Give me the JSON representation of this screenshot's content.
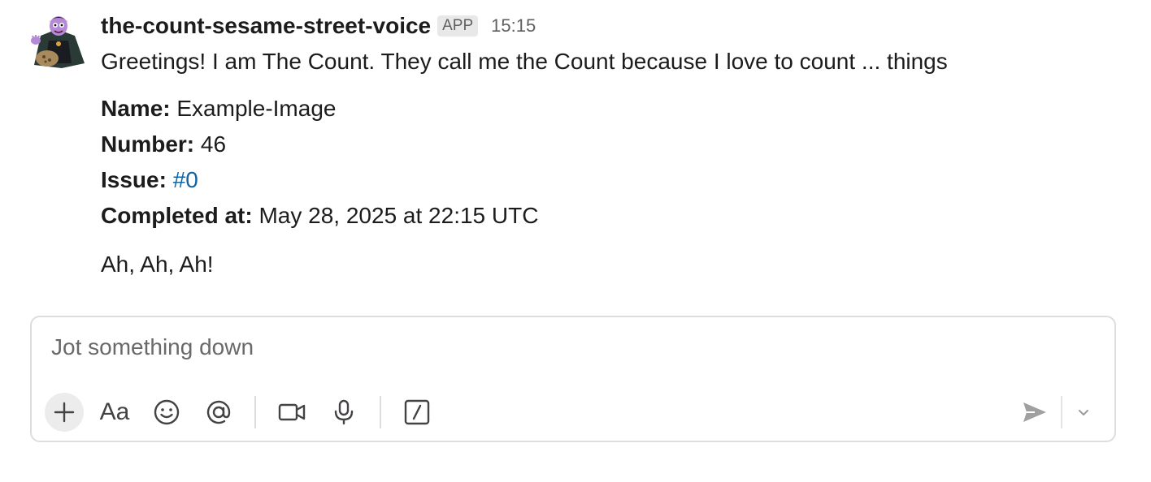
{
  "message": {
    "sender": "the-count-sesame-street-voice",
    "badge": "APP",
    "timestamp": "15:15",
    "greeting": "Greetings! I am The Count. They call me the Count because I love to count ... things",
    "fields": [
      {
        "label": "Name:",
        "value": "Example-Image"
      },
      {
        "label": "Number:",
        "value": "46"
      },
      {
        "label": "Issue:",
        "value": "#0"
      },
      {
        "label": "Completed at:",
        "value": "May 28, 2025 at 22:15 UTC"
      }
    ],
    "signoff": "Ah, Ah, Ah!",
    "avatar_icon": "the-count-avatar"
  },
  "composer": {
    "placeholder": "Jot something down",
    "toolbar": {
      "plus_icon": "plus-icon",
      "format_label": "Aa",
      "emoji_icon": "smiley-icon",
      "mention_icon": "at-icon",
      "video_icon": "video-camera-icon",
      "mic_icon": "microphone-icon",
      "shortcut_icon": "slash-command-icon",
      "send_icon": "send-icon",
      "options_icon": "chevron-down-icon"
    }
  },
  "colors": {
    "link": "#1264a3",
    "muted": "#616061",
    "badge_bg": "#e8e8e8",
    "border": "#dddddd"
  }
}
